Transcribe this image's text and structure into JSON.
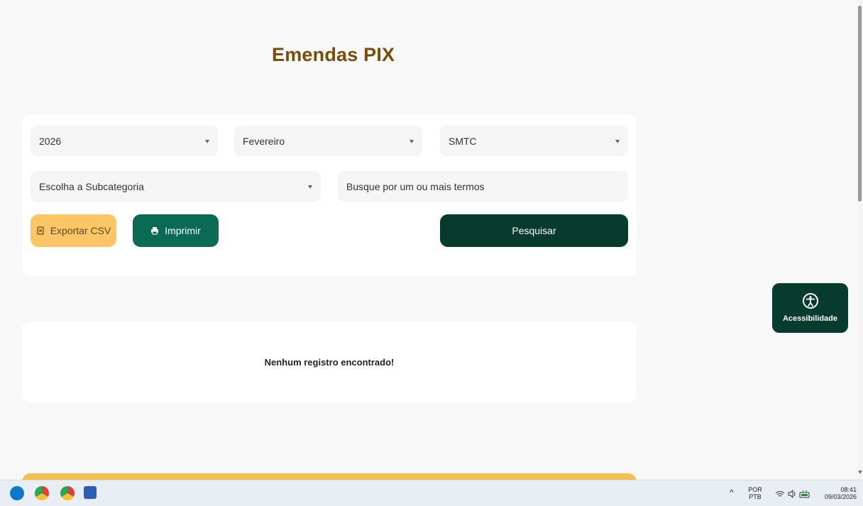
{
  "page": {
    "title": "Emendas PIX"
  },
  "filters": {
    "year": "2026",
    "month": "Fevereiro",
    "organization": "SMTC",
    "subcategory": "Escolha a Subcategoria",
    "search_placeholder": "Busque por um ou mais termos"
  },
  "buttons": {
    "export_csv": "Exportar CSV",
    "print": "Imprimir",
    "search": "Pesquisar"
  },
  "results": {
    "empty_message": "Nenhum registro encontrado!"
  },
  "accessibility": {
    "label": "Acessibilidade"
  },
  "taskbar": {
    "language_top": "POR",
    "language_bottom": "PTB",
    "time": "08:41",
    "date": "09/03/2026"
  },
  "colors": {
    "title": "#7a4d06",
    "export_button": "#fcc566",
    "print_button": "#0b6a53",
    "search_button": "#063b2d",
    "accent_footer": "#f4bf4f"
  },
  "icons": [
    "document-icon",
    "printer-icon",
    "accessibility-icon",
    "edge-icon",
    "chrome-icon",
    "word-icon",
    "wifi-icon",
    "volume-icon",
    "battery-icon"
  ]
}
